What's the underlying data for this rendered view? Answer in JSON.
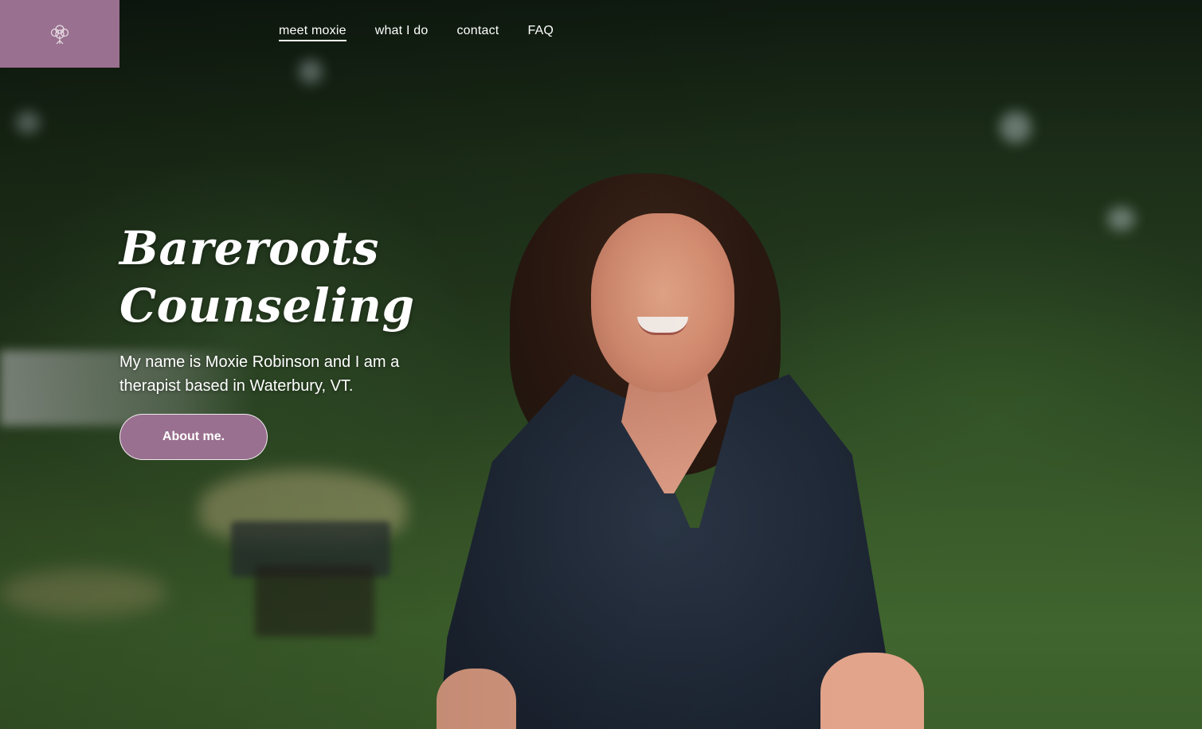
{
  "brand": {
    "logo_icon": "tree-icon",
    "accent_color": "#99708f"
  },
  "nav": {
    "items": [
      {
        "label": "meet moxie",
        "active": true
      },
      {
        "label": "what I do",
        "active": false
      },
      {
        "label": "contact",
        "active": false
      },
      {
        "label": "FAQ",
        "active": false
      }
    ]
  },
  "hero": {
    "title_line1": "Bareroots",
    "title_line2": "Counseling",
    "subtitle": "My name is Moxie Robinson and I am a therapist based in Waterbury, VT.",
    "cta_label": "About me."
  }
}
